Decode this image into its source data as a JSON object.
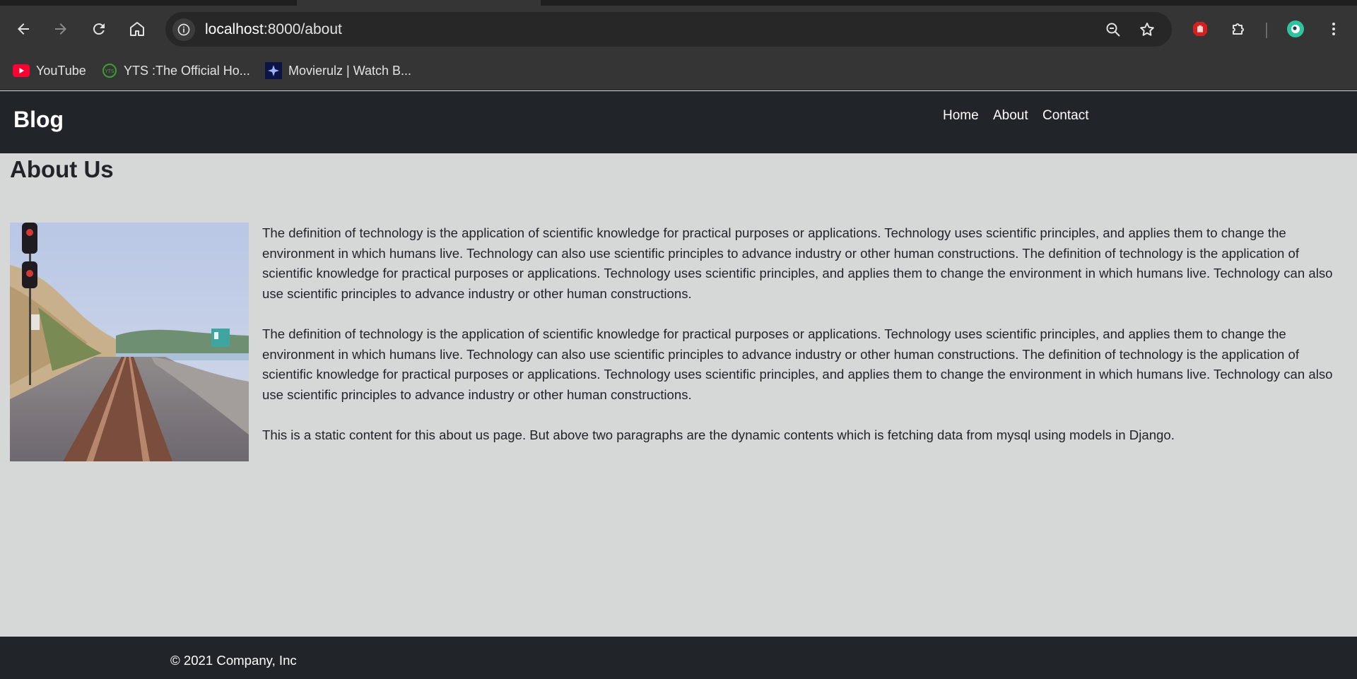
{
  "browser": {
    "url_host": "localhost",
    "url_path": ":8000/about",
    "bookmarks": [
      {
        "label": "YouTube",
        "icon": "youtube-icon"
      },
      {
        "label": "YTS :The Official Ho...",
        "icon": "yts-icon"
      },
      {
        "label": "Movierulz | Watch B...",
        "icon": "movierulz-icon"
      }
    ]
  },
  "navbar": {
    "brand": "Blog",
    "links": [
      "Home",
      "About",
      "Contact"
    ]
  },
  "main": {
    "title": "About Us",
    "paragraphs": [
      "The definition of technology is the application of scientific knowledge for practical purposes or applications. Technology uses scientific principles, and applies them to change the environment in which humans live. Technology can also use scientific principles to advance industry or other human constructions. The definition of technology is the application of scientific knowledge for practical purposes or applications. Technology uses scientific principles, and applies them to change the environment in which humans live. Technology can also use scientific principles to advance industry or other human constructions.",
      "The definition of technology is the application of scientific knowledge for practical purposes or applications. Technology uses scientific principles, and applies them to change the environment in which humans live. Technology can also use scientific principles to advance industry or other human constructions. The definition of technology is the application of scientific knowledge for practical purposes or applications. Technology uses scientific principles, and applies them to change the environment in which humans live. Technology can also use scientific principles to advance industry or other human constructions.",
      "This is a static content for this about us page. But above two paragraphs are the dynamic contents which is fetching data from mysql using models in Django."
    ]
  },
  "footer": {
    "copyright": "© 2021 Company, Inc"
  },
  "colors": {
    "navbar_bg": "#212529",
    "page_bg": "#d6d8d7",
    "chrome_bg": "#353535"
  }
}
